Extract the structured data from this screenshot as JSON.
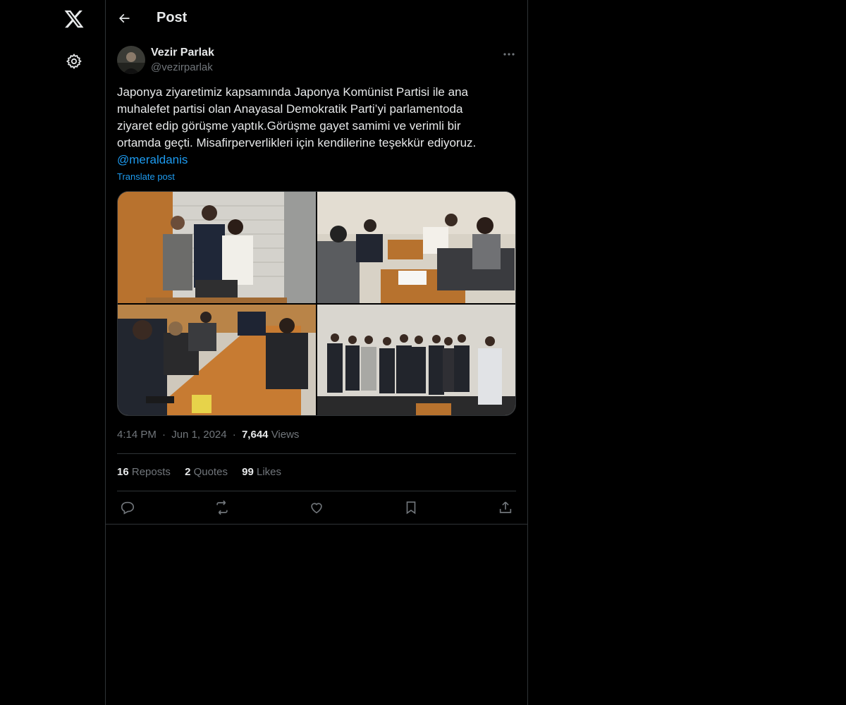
{
  "nav": {
    "logo_icon": "x-logo-icon",
    "settings_icon": "gear-icon"
  },
  "header": {
    "title": "Post"
  },
  "post": {
    "author_name": "Vezir Parlak",
    "author_handle": "@vezirparlak",
    "text_lines": [
      "Japonya ziyaretimiz kapsamında Japonya Komünist Partisi ile ana",
      "muhalefet partisi olan Anayasal Demokratik Parti’yi parlamentoda",
      "ziyaret edip görüşme yaptık.Görüşme gayet samimi ve verimli bir",
      "ortamda geçti. Misafirperverlikleri için kendilerine teşekkür ediyoruz."
    ],
    "mention": "@meraldanis",
    "translate_label": "Translate post",
    "time": "4:14 PM",
    "date": "Jun 1, 2024",
    "separator": "·",
    "views_count": "7,644",
    "views_label": "Views"
  },
  "stats": {
    "reposts_count": "16",
    "reposts_label": "Reposts",
    "quotes_count": "2",
    "quotes_label": "Quotes",
    "likes_count": "99",
    "likes_label": "Likes"
  },
  "colors": {
    "background": "#000000",
    "text": "#e7e9ea",
    "muted": "#71767b",
    "accent": "#1d9bf0",
    "border": "#2f3336"
  }
}
